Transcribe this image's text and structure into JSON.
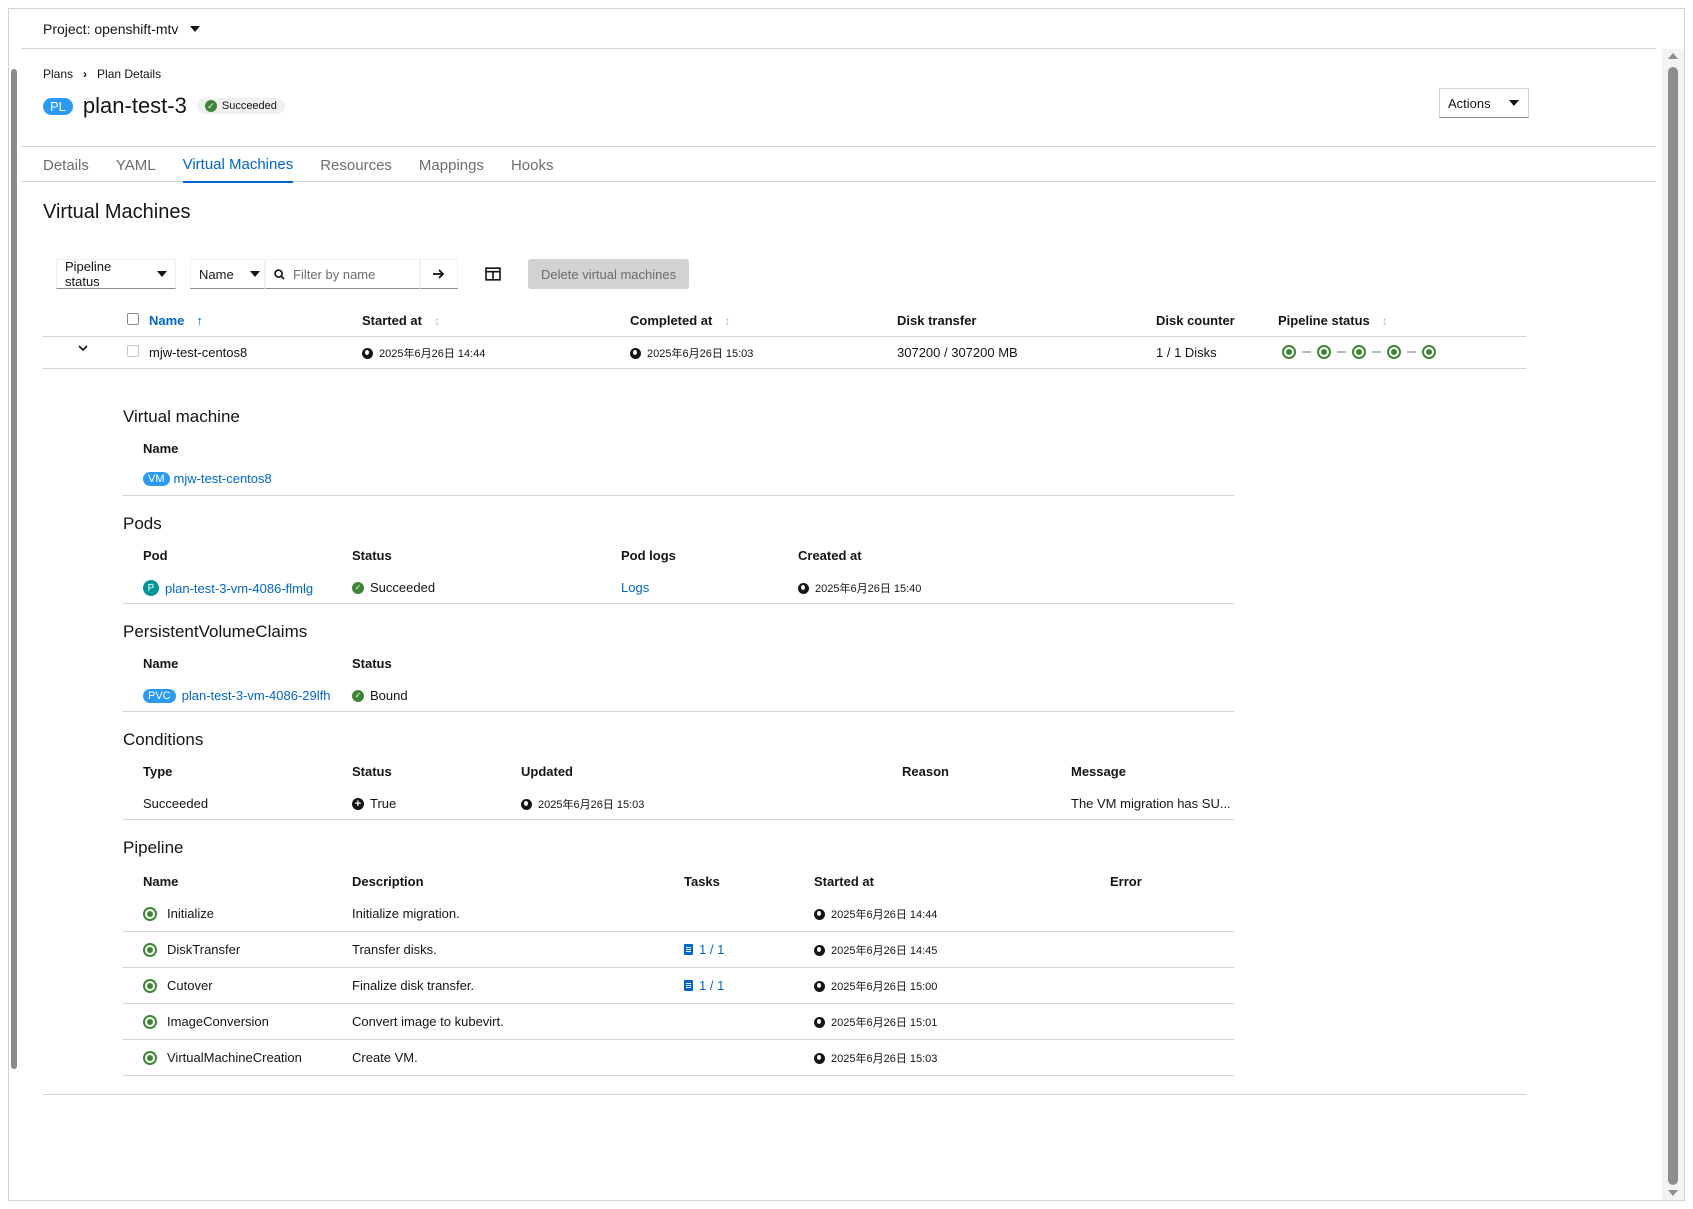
{
  "project": {
    "label": "Project: openshift-mtv"
  },
  "breadcrumb": {
    "root": "Plans",
    "current": "Plan Details"
  },
  "plan": {
    "badge": "PL",
    "name": "plan-test-3",
    "status": "Succeeded"
  },
  "actions": {
    "label": "Actions"
  },
  "tabs": [
    {
      "label": "Details"
    },
    {
      "label": "YAML"
    },
    {
      "label": "Virtual Machines"
    },
    {
      "label": "Resources"
    },
    {
      "label": "Mappings"
    },
    {
      "label": "Hooks"
    }
  ],
  "active_tab": "Virtual Machines",
  "section_title": "Virtual Machines",
  "toolbar": {
    "pipeline_filter": "Pipeline status",
    "attribute_filter": "Name",
    "search_placeholder": "Filter by name",
    "delete_label": "Delete virtual machines"
  },
  "vm_table": {
    "headers": {
      "name": "Name",
      "started": "Started at",
      "completed": "Completed at",
      "disk_transfer": "Disk transfer",
      "disk_counter": "Disk counter",
      "pipeline": "Pipeline status"
    },
    "rows": [
      {
        "name": "mjw-test-centos8",
        "started": "2025年6月26日 14:44",
        "completed": "2025年6月26日 15:03",
        "disk_transfer": "307200 / 307200 MB",
        "disk_counter": "1 / 1 Disks",
        "pipeline_steps_complete": 5
      }
    ]
  },
  "details": {
    "virtual_machine": {
      "title": "Virtual machine",
      "name_header": "Name",
      "badge": "VM",
      "name": "mjw-test-centos8"
    },
    "pods": {
      "title": "Pods",
      "headers": {
        "pod": "Pod",
        "status": "Status",
        "logs": "Pod logs",
        "created": "Created at"
      },
      "row": {
        "badge": "P",
        "pod": "plan-test-3-vm-4086-flmlg",
        "status": "Succeeded",
        "logs": "Logs",
        "created": "2025年6月26日 15:40"
      }
    },
    "pvcs": {
      "title": "PersistentVolumeClaims",
      "headers": {
        "name": "Name",
        "status": "Status"
      },
      "row": {
        "badge": "PVC",
        "name": "plan-test-3-vm-4086-29lfh",
        "status": "Bound"
      }
    },
    "conditions": {
      "title": "Conditions",
      "headers": {
        "type": "Type",
        "status": "Status",
        "updated": "Updated",
        "reason": "Reason",
        "message": "Message"
      },
      "row": {
        "type": "Succeeded",
        "status": "True",
        "updated": "2025年6月26日 15:03",
        "reason": "",
        "message": "The VM migration has SU..."
      }
    },
    "pipeline": {
      "title": "Pipeline",
      "headers": {
        "name": "Name",
        "description": "Description",
        "tasks": "Tasks",
        "started": "Started at",
        "error": "Error"
      },
      "rows": [
        {
          "name": "Initialize",
          "description": "Initialize migration.",
          "tasks": "",
          "started": "2025年6月26日 14:44"
        },
        {
          "name": "DiskTransfer",
          "description": "Transfer disks.",
          "tasks": "1 / 1",
          "started": "2025年6月26日 14:45"
        },
        {
          "name": "Cutover",
          "description": "Finalize disk transfer.",
          "tasks": "1 / 1",
          "started": "2025年6月26日 15:00"
        },
        {
          "name": "ImageConversion",
          "description": "Convert image to kubevirt.",
          "tasks": "",
          "started": "2025年6月26日 15:01"
        },
        {
          "name": "VirtualMachineCreation",
          "description": "Create VM.",
          "tasks": "",
          "started": "2025年6月26日 15:03"
        }
      ]
    }
  },
  "colors": {
    "link": "#0066cc",
    "success": "#3e8635",
    "badge_blue": "#2b9af3",
    "badge_teal": "#009596"
  }
}
